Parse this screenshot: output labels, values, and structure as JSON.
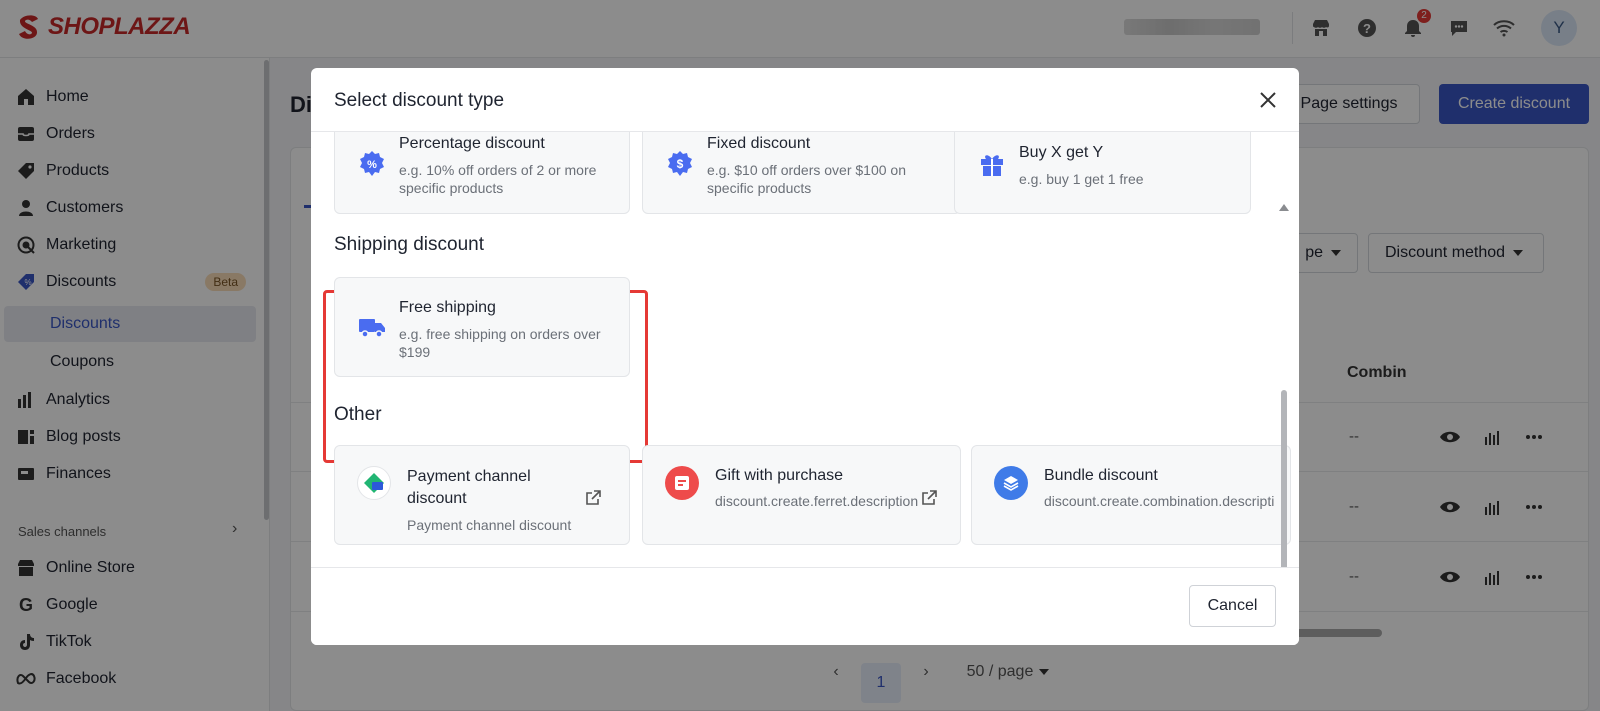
{
  "brand": {
    "name": "SHOPLAZZA"
  },
  "topbar": {
    "notification_count": "2",
    "avatar_initial": "Y"
  },
  "sidebar": {
    "items": [
      {
        "label": "Home",
        "icon": "home-icon"
      },
      {
        "label": "Orders",
        "icon": "orders-icon"
      },
      {
        "label": "Products",
        "icon": "tag-icon"
      },
      {
        "label": "Customers",
        "icon": "person-icon"
      },
      {
        "label": "Marketing",
        "icon": "target-icon"
      },
      {
        "label": "Discounts",
        "icon": "discount-icon",
        "badge": "Beta"
      }
    ],
    "sub_items": [
      {
        "label": "Discounts",
        "active": true
      },
      {
        "label": "Coupons",
        "active": false
      }
    ],
    "items_after": [
      {
        "label": "Analytics",
        "icon": "bar-chart-icon"
      },
      {
        "label": "Blog posts",
        "icon": "blog-icon"
      },
      {
        "label": "Finances",
        "icon": "finance-icon"
      }
    ],
    "sales_channels_label": "Sales channels",
    "channels": [
      {
        "label": "Online Store",
        "icon": "store-icon"
      },
      {
        "label": "Google",
        "icon": "google-icon"
      },
      {
        "label": "TikTok",
        "icon": "tiktok-icon"
      },
      {
        "label": "Facebook",
        "icon": "meta-icon"
      }
    ]
  },
  "page": {
    "title_partial": "Di",
    "page_settings_label": "Page settings",
    "create_label": "Create discount",
    "filter_type_partial": "pe",
    "filter_method_label": "Discount method",
    "column_combin": "Combin",
    "row_values": [
      "--",
      "--",
      "--"
    ],
    "pager": {
      "current": "1",
      "per_page": "50 / page"
    }
  },
  "modal": {
    "title": "Select discount type",
    "top_cards": [
      {
        "title": "Percentage discount",
        "desc": "e.g. 10% off orders of 2 or more specific products",
        "icon": "percent-badge-icon"
      },
      {
        "title": "Fixed discount",
        "desc": "e.g. $10 off orders over $100 on specific products",
        "icon": "dollar-badge-icon"
      },
      {
        "title": "Buy X get Y",
        "desc": "e.g. buy 1 get 1 free",
        "icon": "gift-icon"
      }
    ],
    "shipping_section": "Shipping discount",
    "shipping_card": {
      "title": "Free shipping",
      "desc": "e.g. free shipping on orders over $199",
      "icon": "truck-icon"
    },
    "other_section": "Other",
    "other_cards": [
      {
        "title": "Payment channel discount",
        "desc": "Payment channel discount",
        "icon": "payment-channel-icon"
      },
      {
        "title": "Gift with purchase",
        "desc": "discount.create.ferret.description",
        "icon": "gift-purchase-icon"
      },
      {
        "title": "Bundle discount",
        "desc": "discount.create.combination.description",
        "icon": "bundle-icon"
      }
    ],
    "cancel_label": "Cancel"
  },
  "colors": {
    "accent": "#3a56c5",
    "highlight": "#e53935",
    "icon_blue": "#4a6cf0"
  }
}
